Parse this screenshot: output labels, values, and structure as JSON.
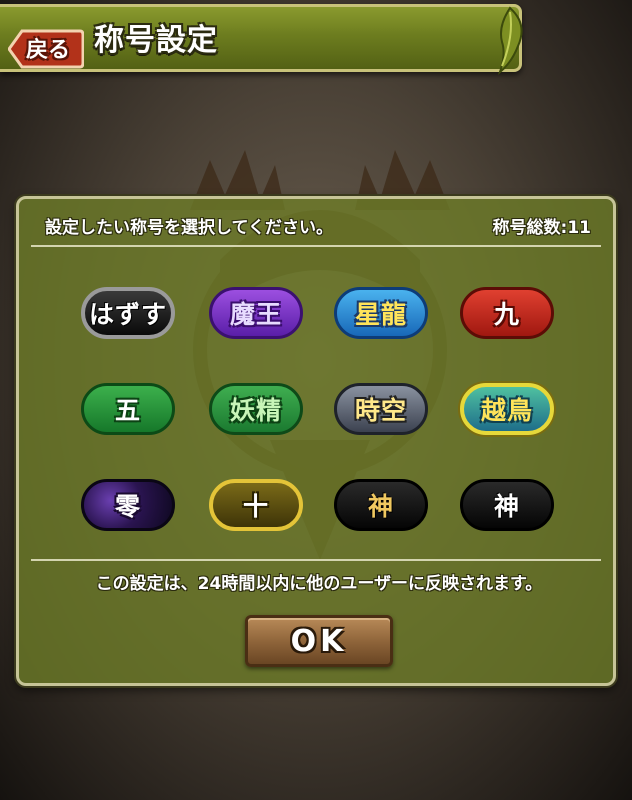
{
  "header": {
    "title": "称号設定",
    "back_label": "戻る"
  },
  "dialog": {
    "instruction": "設定したい称号を選択してください。",
    "total_label": "称号総数:11",
    "notice": "この設定は、24時間以内に他のユーザーに反映されます。",
    "ok_label": "OK",
    "titles": [
      {
        "label": "はずす",
        "style": "black"
      },
      {
        "label": "魔王",
        "style": "purple"
      },
      {
        "label": "星龍",
        "style": "blue"
      },
      {
        "label": "九",
        "style": "red"
      },
      {
        "label": "五",
        "style": "green"
      },
      {
        "label": "妖精",
        "style": "green"
      },
      {
        "label": "時空",
        "style": "steel"
      },
      {
        "label": "越鳥",
        "style": "sea-gold-border"
      },
      {
        "label": "零",
        "style": "galaxy"
      },
      {
        "label": "十",
        "style": "gold-border"
      },
      {
        "label": "神",
        "style": "dark-gold-text"
      },
      {
        "label": "神",
        "style": "dark-white-text"
      }
    ]
  },
  "colors": {
    "panel_green": "#6e7e28",
    "header_green": "#7a8a26",
    "ok_brown": "#8c6238"
  }
}
